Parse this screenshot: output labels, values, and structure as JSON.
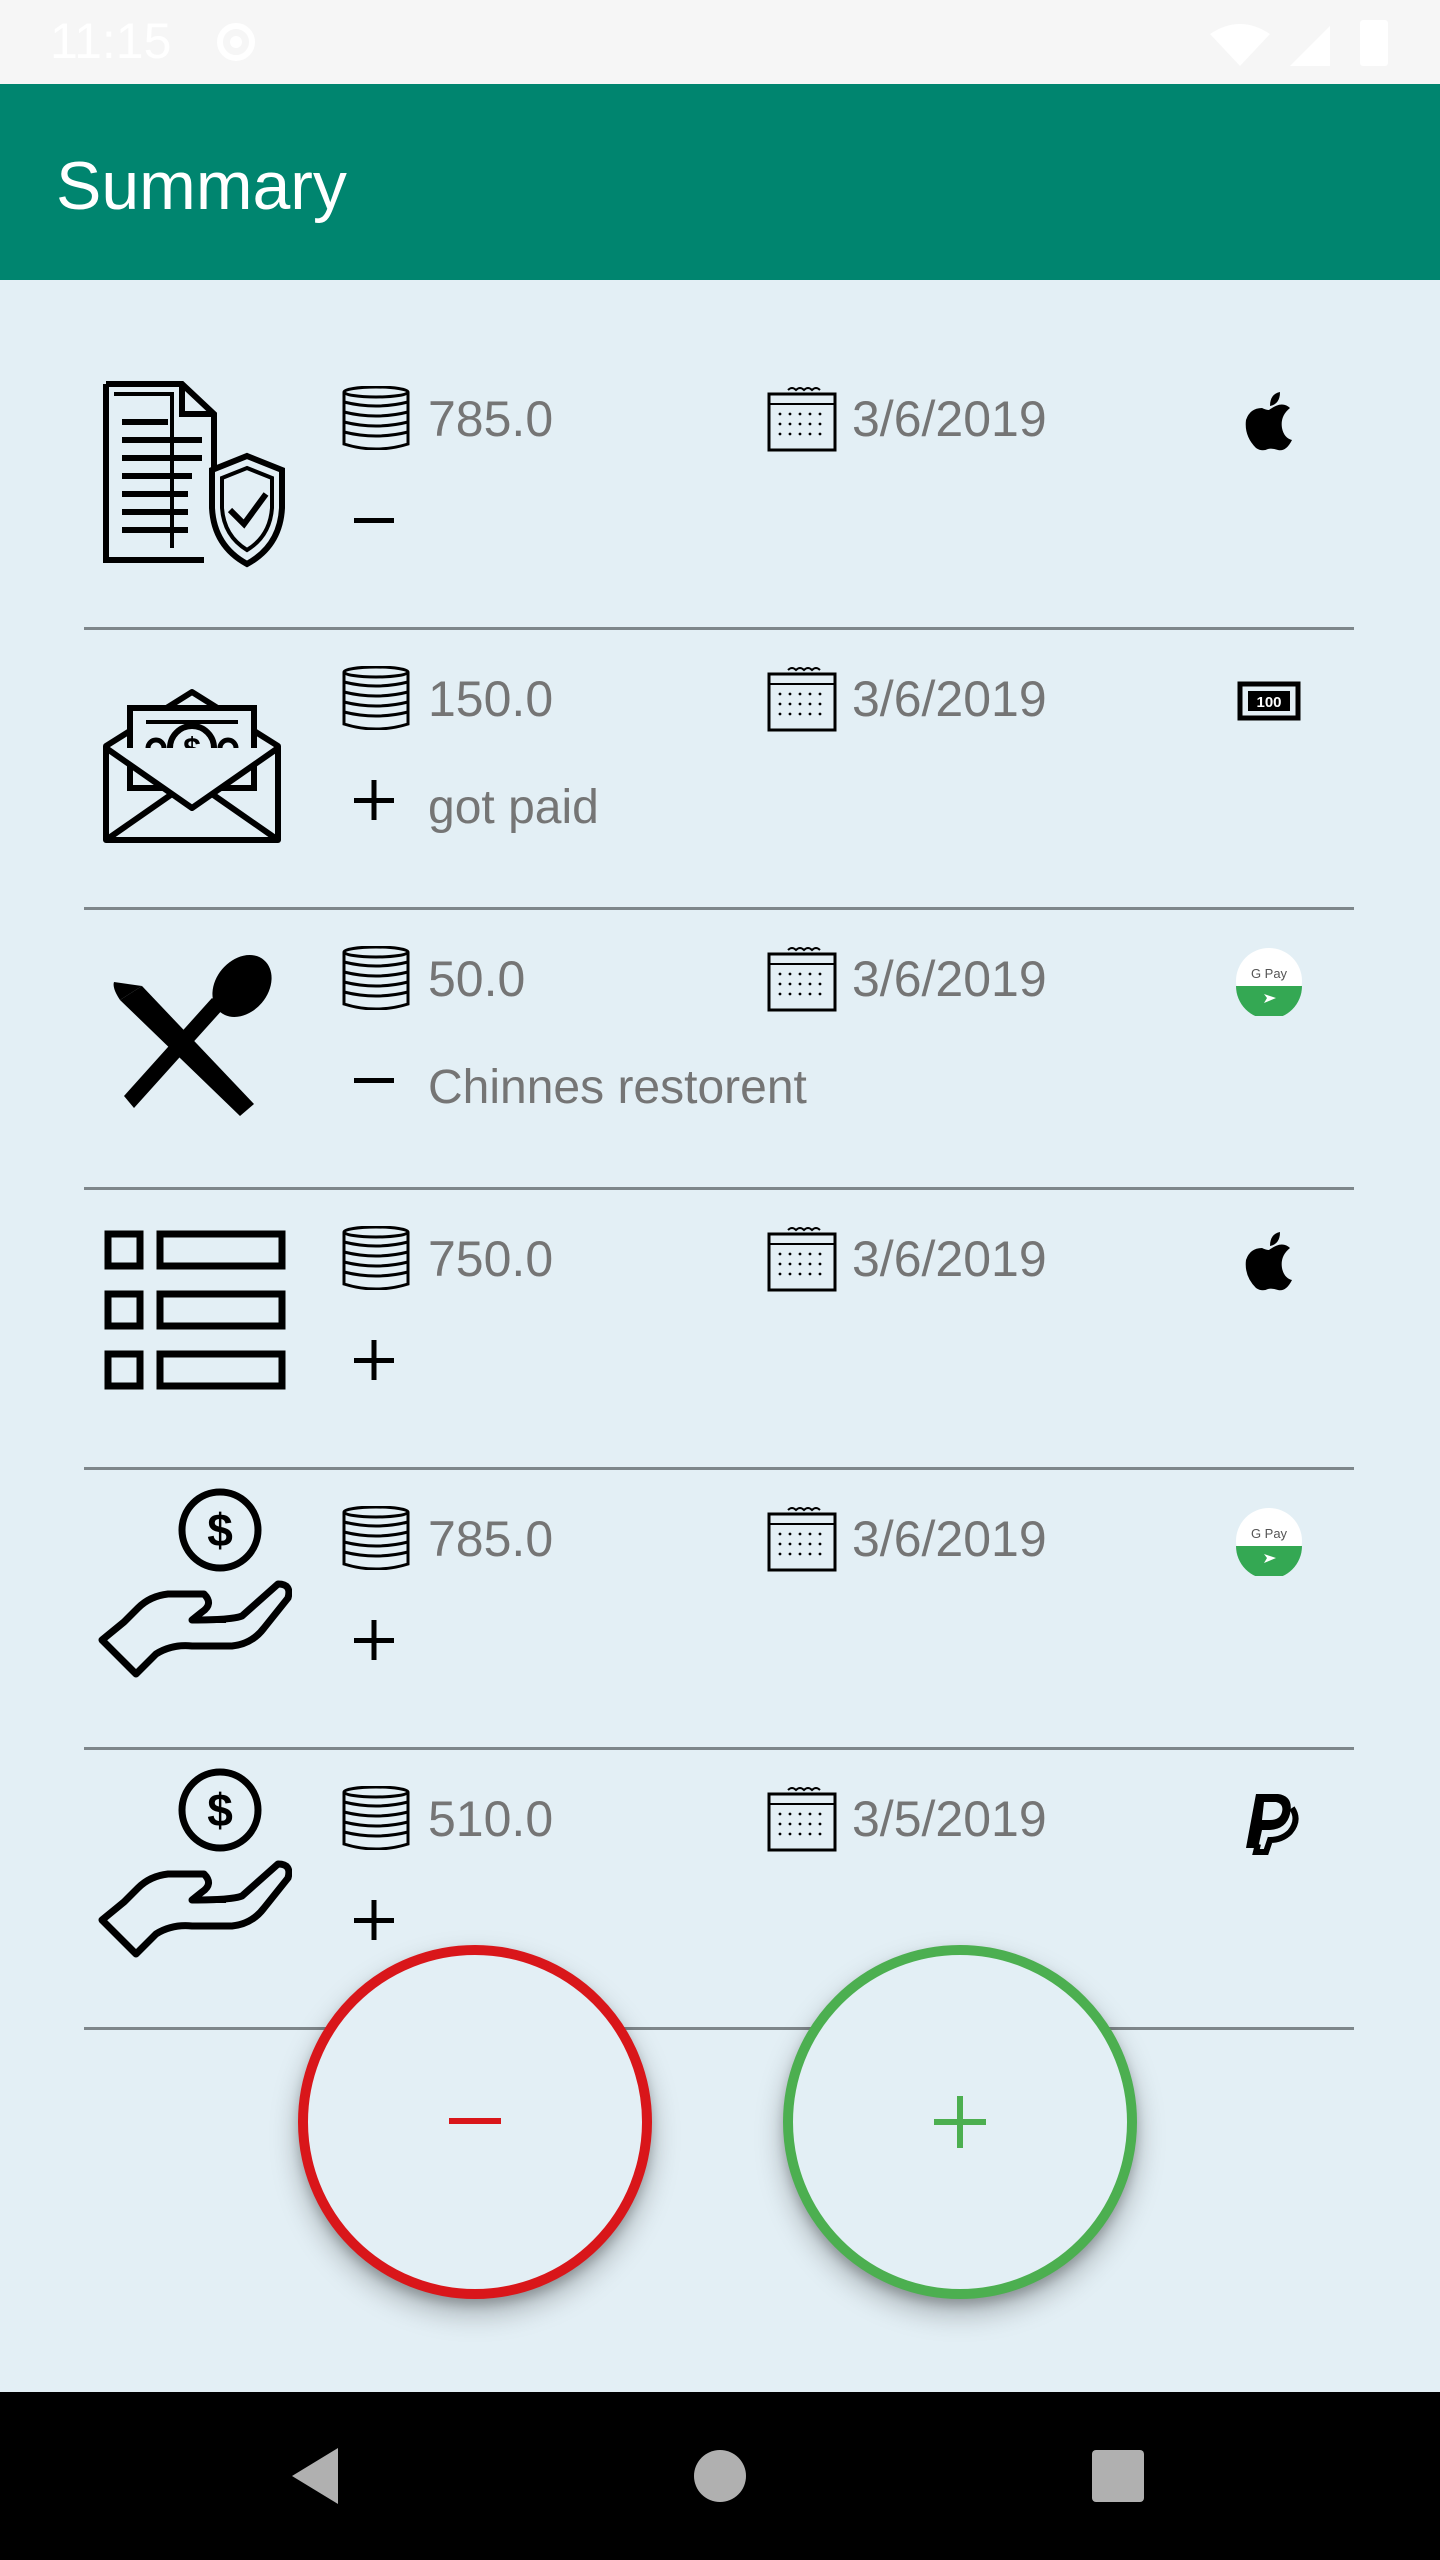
{
  "status_bar": {
    "time": "11:15"
  },
  "app_bar": {
    "title": "Summary"
  },
  "transactions": [
    {
      "category_icon": "insurance-document-icon",
      "amount": "785.0",
      "date": "3/6/2019",
      "payment_icon": "apple-pay-icon",
      "sign": "minus",
      "note": ""
    },
    {
      "category_icon": "salary-envelope-icon",
      "amount": "150.0",
      "date": "3/6/2019",
      "payment_icon": "cash-banknote-icon",
      "sign": "plus",
      "note": "got paid"
    },
    {
      "category_icon": "restaurant-cutlery-icon",
      "amount": "50.0",
      "date": "3/6/2019",
      "payment_icon": "google-pay-icon",
      "sign": "minus",
      "note": "Chinnes restorent"
    },
    {
      "category_icon": "list-icon",
      "amount": "750.0",
      "date": "3/6/2019",
      "payment_icon": "apple-pay-icon",
      "sign": "plus",
      "note": ""
    },
    {
      "category_icon": "hand-money-icon",
      "amount": "785.0",
      "date": "3/6/2019",
      "payment_icon": "google-pay-icon",
      "sign": "plus",
      "note": ""
    },
    {
      "category_icon": "hand-money-icon",
      "amount": "510.0",
      "date": "3/5/2019",
      "payment_icon": "paypal-icon",
      "sign": "plus",
      "note": ""
    }
  ],
  "fabs": {
    "expense_color": "#d9161a",
    "income_color": "#4caf50"
  },
  "colors": {
    "app_bar": "#00856f",
    "background": "#e3eff5",
    "text_secondary": "#757575"
  }
}
